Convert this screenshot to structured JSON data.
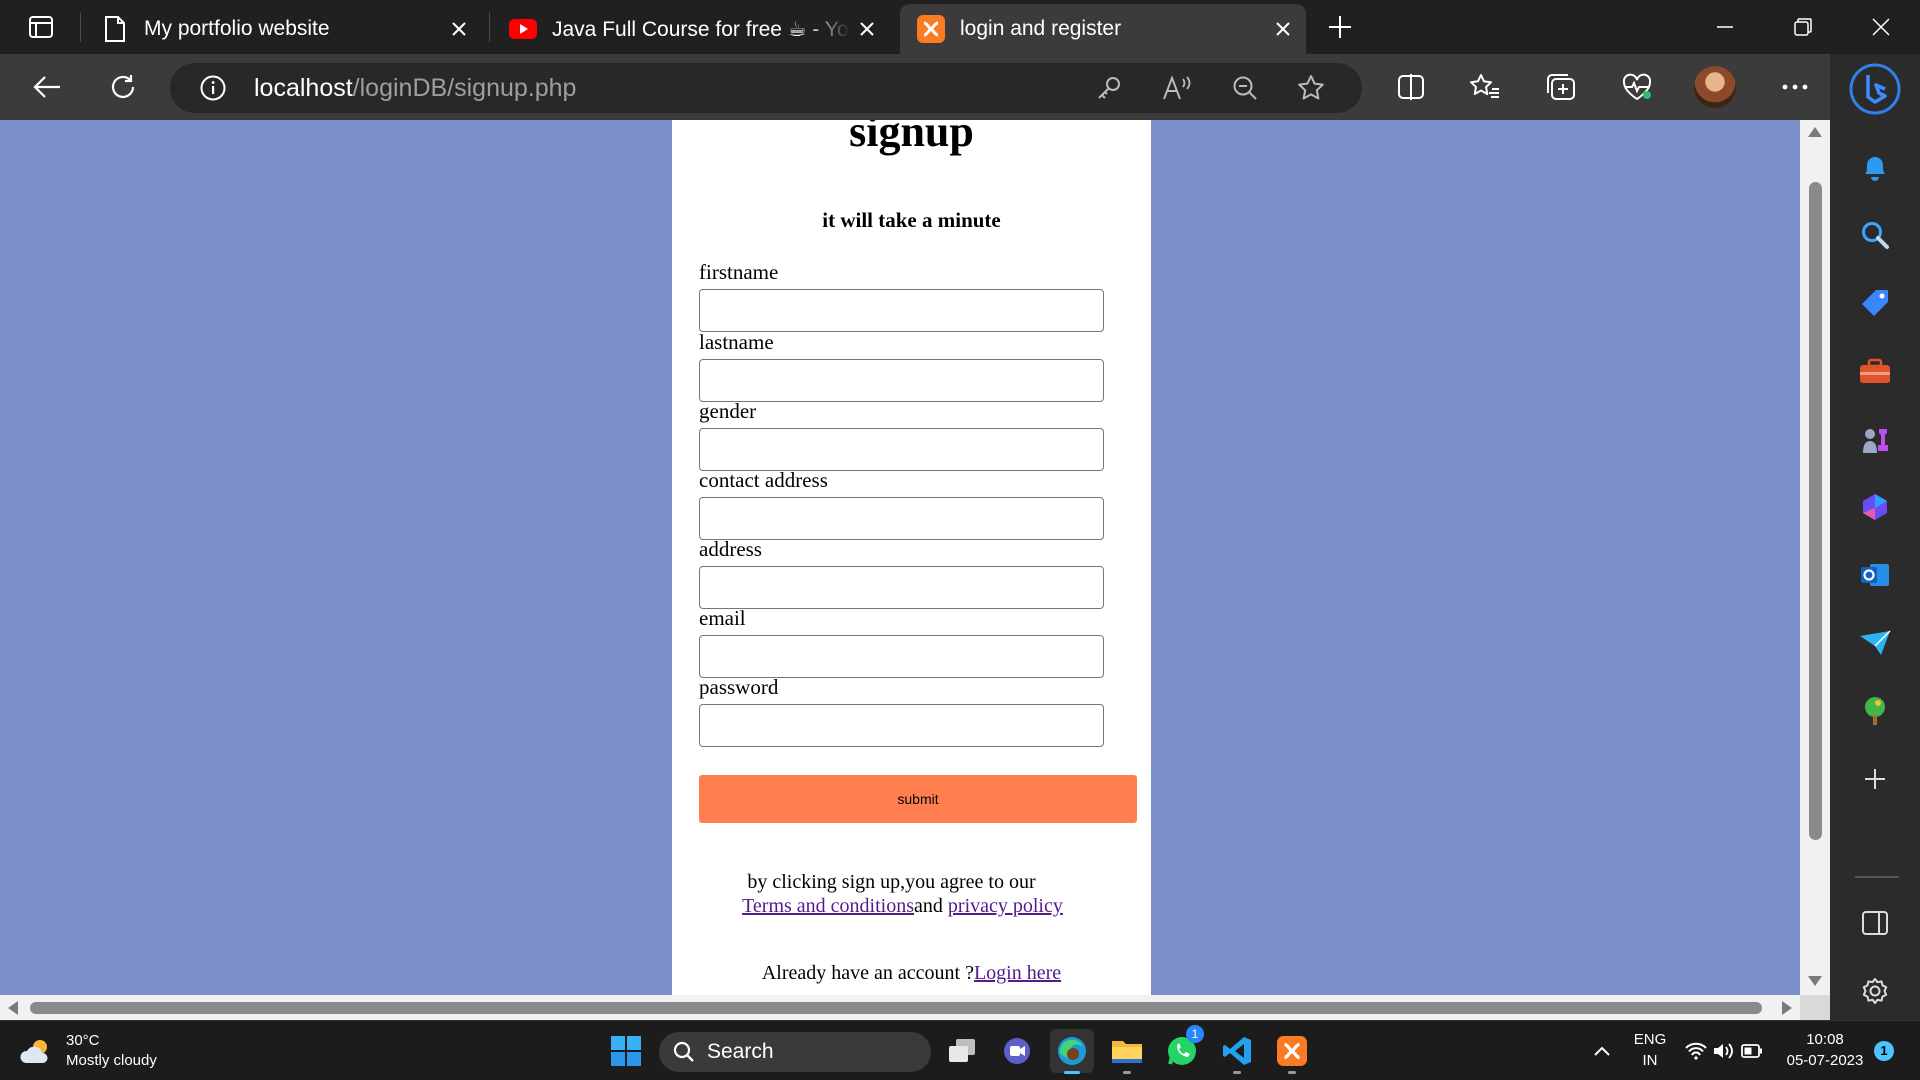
{
  "browser": {
    "tabs": [
      {
        "title": "My portfolio website",
        "icon": "document-icon"
      },
      {
        "title": "Java Full Course for free ☕ - YouTube",
        "icon": "youtube-icon"
      },
      {
        "title": "login and register",
        "icon": "xampp-icon",
        "active": true
      }
    ],
    "url_host": "localhost",
    "url_path": "/loginDB/signup.php"
  },
  "page": {
    "background": "#7b90c9",
    "title": "signup",
    "subtitle": "it will take a minute",
    "fields": [
      {
        "label": "firstname",
        "value": ""
      },
      {
        "label": "lastname",
        "value": ""
      },
      {
        "label": "gender",
        "value": ""
      },
      {
        "label": "contact address",
        "value": ""
      },
      {
        "label": "address",
        "value": ""
      },
      {
        "label": "email",
        "value": ""
      },
      {
        "label": "password",
        "value": ""
      }
    ],
    "submit_label": "submit",
    "submit_color": "#ff7f50",
    "agree_text": "by clicking sign up,you agree to our",
    "terms_link": "Terms and conditions",
    "and_text": "and",
    "privacy_link": "privacy policy",
    "already_text": "Already have an account ?",
    "login_link": "Login here"
  },
  "taskbar": {
    "temperature": "30°C",
    "weather": "Mostly cloudy",
    "search_label": "Search",
    "lang_primary": "ENG",
    "lang_secondary": "IN",
    "time": "10:08",
    "date": "05-07-2023",
    "notification_count": "1",
    "whatsapp_badge": "1"
  }
}
